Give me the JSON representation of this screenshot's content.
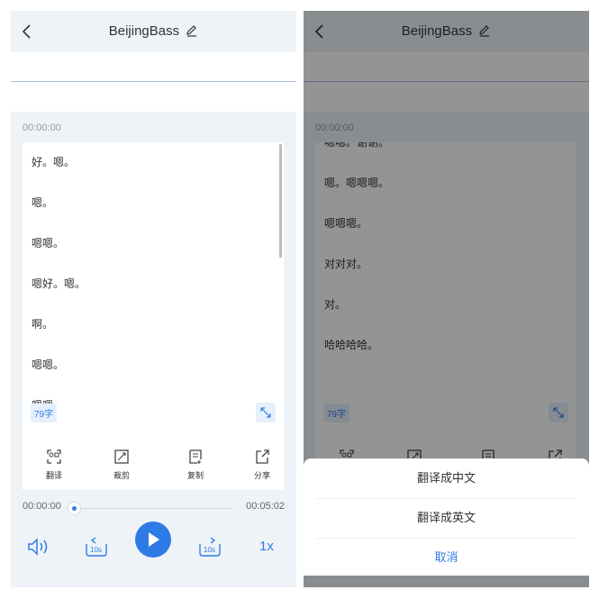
{
  "header": {
    "title": "BeijingBass"
  },
  "transcript": {
    "timestamp": "00:00:00",
    "char_count": "79字",
    "left_lines": [
      "好。嗯。",
      "嗯。",
      "嗯嗯。",
      "嗯好。嗯。",
      "啊。",
      "嗯嗯。",
      "嗯嗯"
    ],
    "right_lines": [
      "嗯嗯。谢谢。",
      "嗯。嗯嗯嗯。",
      "嗯嗯嗯。",
      "对对对。",
      "对。",
      "哈哈哈哈。"
    ]
  },
  "toolbar": {
    "items": [
      {
        "label": "翻译",
        "icon": "translate-icon"
      },
      {
        "label": "裁剪",
        "icon": "crop-icon"
      },
      {
        "label": "复制",
        "icon": "copy-icon"
      },
      {
        "label": "分享",
        "icon": "share-icon"
      }
    ]
  },
  "player": {
    "current_time": "00:00:00",
    "total_time": "00:05:02",
    "progress": 0,
    "skip_back": "10s",
    "skip_forward": "10s",
    "speed": "1x"
  },
  "action_sheet": {
    "options": [
      "翻译成中文",
      "翻译成英文"
    ],
    "cancel": "取消"
  },
  "colors": {
    "accent": "#2f7be6",
    "page_bg": "#eef3f8"
  }
}
